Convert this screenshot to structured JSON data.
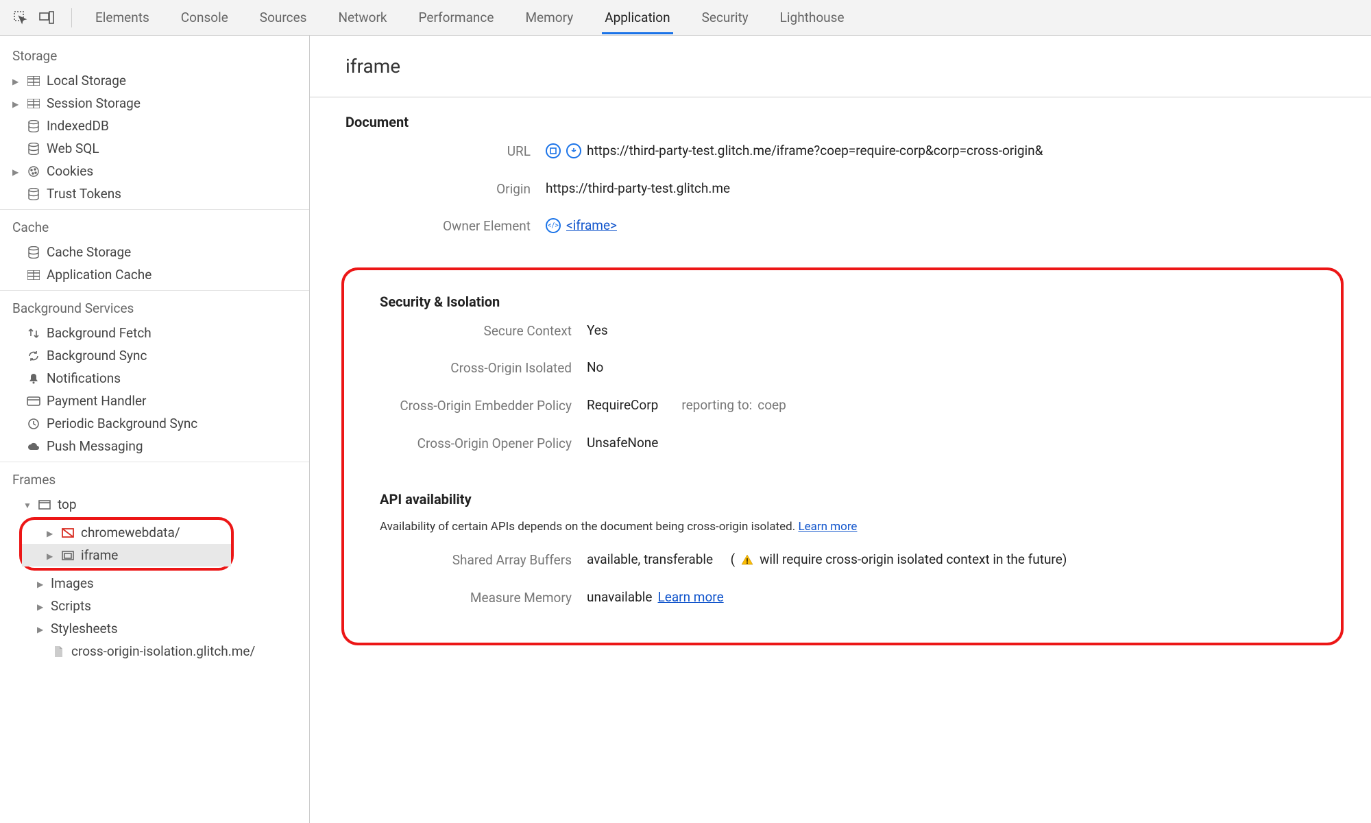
{
  "topbar": {
    "tabs": [
      "Elements",
      "Console",
      "Sources",
      "Network",
      "Performance",
      "Memory",
      "Application",
      "Security",
      "Lighthouse"
    ],
    "active": "Application"
  },
  "sidebar": {
    "storage": {
      "title": "Storage",
      "items": [
        "Local Storage",
        "Session Storage",
        "IndexedDB",
        "Web SQL",
        "Cookies",
        "Trust Tokens"
      ]
    },
    "cache": {
      "title": "Cache",
      "items": [
        "Cache Storage",
        "Application Cache"
      ]
    },
    "bgservices": {
      "title": "Background Services",
      "items": [
        "Background Fetch",
        "Background Sync",
        "Notifications",
        "Payment Handler",
        "Periodic Background Sync",
        "Push Messaging"
      ]
    },
    "frames": {
      "title": "Frames",
      "top_label": "top",
      "chromewebdata": "chromewebdata/",
      "iframe": "iframe",
      "images": "Images",
      "scripts": "Scripts",
      "stylesheets": "Stylesheets",
      "leaf": "cross-origin-isolation.glitch.me/"
    }
  },
  "content": {
    "title": "iframe",
    "document": {
      "heading": "Document",
      "url_label": "URL",
      "url_value": "https://third-party-test.glitch.me/iframe?coep=require-corp&corp=cross-origin&",
      "origin_label": "Origin",
      "origin_value": "https://third-party-test.glitch.me",
      "owner_label": "Owner Element",
      "owner_link": "<iframe>"
    },
    "security": {
      "heading": "Security & Isolation",
      "secure_context_label": "Secure Context",
      "secure_context_value": "Yes",
      "coi_label": "Cross-Origin Isolated",
      "coi_value": "No",
      "coep_label": "Cross-Origin Embedder Policy",
      "coep_value": "RequireCorp",
      "coep_reporting_prefix": "reporting to:",
      "coep_reporting_value": "coep",
      "coop_label": "Cross-Origin Opener Policy",
      "coop_value": "UnsafeNone"
    },
    "api": {
      "heading": "API availability",
      "desc_prefix": "Availability of certain APIs depends on the document being cross-origin isolated.",
      "learn_more": "Learn more",
      "sab_label": "Shared Array Buffers",
      "sab_value": "available, transferable",
      "sab_note_prefix": "(",
      "sab_note": "will require cross-origin isolated context in the future)",
      "mm_label": "Measure Memory",
      "mm_value": "unavailable",
      "mm_learn_more": "Learn more"
    }
  }
}
